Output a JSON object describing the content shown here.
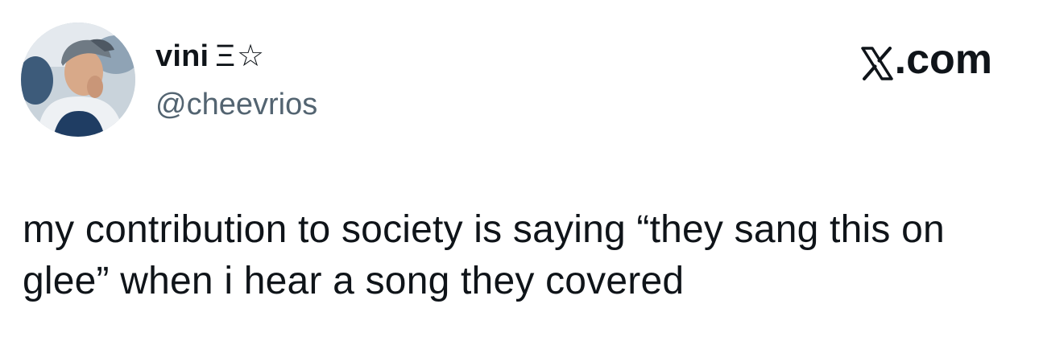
{
  "author": {
    "display_name": "vini",
    "name_badge": "Ξ☆",
    "handle": "@cheevrios"
  },
  "brand": {
    "domain_label": ".com",
    "logo_icon": "x-logo-icon"
  },
  "tweet": {
    "text": "my contribution to society is saying “they sang this on glee” when i hear a song they covered"
  },
  "colors": {
    "text": "#0f1419",
    "secondary_text": "#536471",
    "background": "#ffffff"
  }
}
